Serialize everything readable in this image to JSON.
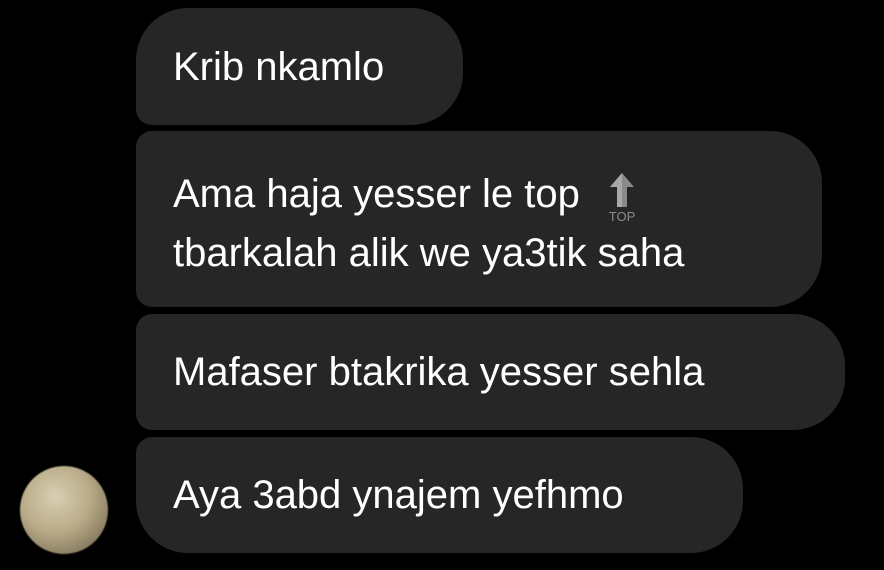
{
  "messages": [
    {
      "text": "Krib nkamlo"
    },
    {
      "line1": "Ama haja yesser le top",
      "emoji": "top-arrow-icon",
      "line2": "tbarkalah alik we ya3tik saha"
    },
    {
      "text": "Mafaser btakrika yesser sehla"
    },
    {
      "text": "Aya 3abd ynajem yefhmo"
    }
  ],
  "emoji_top_label": "TOP",
  "sender": {
    "avatar": "avatar"
  },
  "colors": {
    "background": "#000000",
    "bubble": "#262626",
    "text": "#ffffff"
  }
}
